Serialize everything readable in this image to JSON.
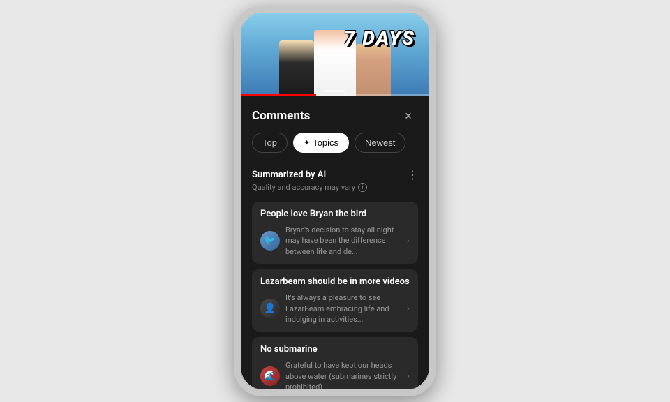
{
  "phone": {
    "video": {
      "days_text": "7 DAYS",
      "progress_percent": 40
    },
    "comments": {
      "title": "Comments",
      "close_label": "×",
      "tabs": [
        {
          "id": "top",
          "label": "Top",
          "active": false
        },
        {
          "id": "topics",
          "label": "Topics",
          "active": true,
          "icon": "✦"
        },
        {
          "id": "newest",
          "label": "Newest",
          "active": false
        }
      ],
      "ai_section": {
        "title": "Summarized by AI",
        "subtitle": "Quality and accuracy may vary",
        "more_icon": "⋮"
      },
      "topic_cards": [
        {
          "id": "card-1",
          "title": "People love Bryan the bird",
          "preview": "Bryan's decision to stay all night may have been the difference between life and de...",
          "avatar_emoji": "🐦"
        },
        {
          "id": "card-2",
          "title": "Lazarbeam should be in more videos",
          "preview": "It's always a pleasure to see LazarBeam embracing life and indulging in activities...",
          "avatar_emoji": "👤"
        },
        {
          "id": "card-3",
          "title": "No submarine",
          "preview": "Grateful to have kept our heads above water (submarines strictly prohibited).",
          "avatar_emoji": "🌊"
        }
      ]
    }
  }
}
